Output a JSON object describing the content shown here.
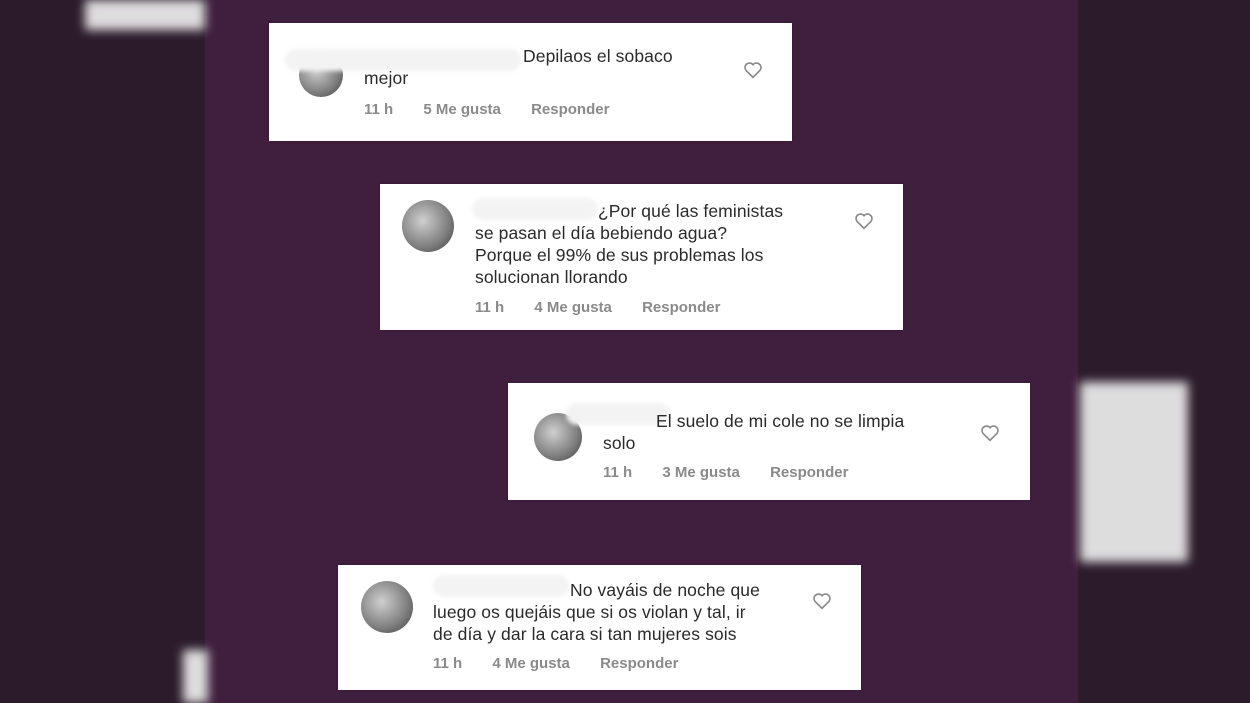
{
  "comments": [
    {
      "text_line1": "Depilaos el sobaco",
      "text_line2": "mejor",
      "time": "11 h",
      "likes": "5 Me gusta",
      "reply": "Responder"
    },
    {
      "text_line1": "¿Por qué las feministas",
      "text_line2": "se pasan el día bebiendo agua?",
      "text_line3": "Porque el 99% de sus problemas los",
      "text_line4": "solucionan llorando",
      "time": "11 h",
      "likes": "4 Me gusta",
      "reply": "Responder"
    },
    {
      "text_line1": "El suelo de mi cole no se limpia",
      "text_line2": "solo",
      "time": "11 h",
      "likes": "3 Me gusta",
      "reply": "Responder"
    },
    {
      "text_line1": "No vayáis de noche que",
      "text_line2": "luego os quejáis que si os violan y tal, ir",
      "text_line3": "de día y dar la cara si tan mujeres sois",
      "time": "11 h",
      "likes": "4 Me gusta",
      "reply": "Responder"
    }
  ]
}
